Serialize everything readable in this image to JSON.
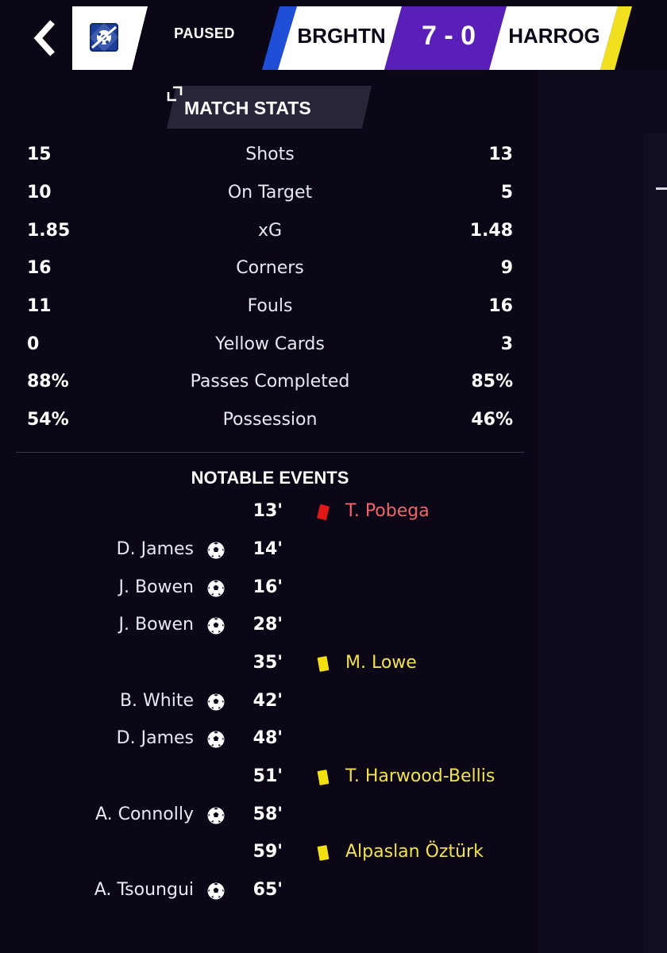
{
  "header": {
    "status": "PAUSED",
    "home_team": "BRGHTN",
    "away_team": "HARROG",
    "score": "7 - 0",
    "colors": {
      "home_stripe": "#1f4fd6",
      "score_bg": "#5a1fb8",
      "away_stripe": "#f0e020"
    }
  },
  "stats_tab": {
    "label": "MATCH STATS"
  },
  "stats": [
    {
      "label": "Shots",
      "home": "15",
      "away": "13"
    },
    {
      "label": "On Target",
      "home": "10",
      "away": "5"
    },
    {
      "label": "xG",
      "home": "1.85",
      "away": "1.48"
    },
    {
      "label": "Corners",
      "home": "16",
      "away": "9"
    },
    {
      "label": "Fouls",
      "home": "11",
      "away": "16"
    },
    {
      "label": "Yellow Cards",
      "home": "0",
      "away": "3"
    },
    {
      "label": "Passes Completed",
      "home": "88%",
      "away": "85%"
    },
    {
      "label": "Possession",
      "home": "54%",
      "away": "46%"
    }
  ],
  "events_title": "NOTABLE EVENTS",
  "events": [
    {
      "minute": "13'",
      "side": "away",
      "type": "red-card",
      "player": "T. Pobega"
    },
    {
      "minute": "14'",
      "side": "home",
      "type": "goal",
      "player": "D. James"
    },
    {
      "minute": "16'",
      "side": "home",
      "type": "goal",
      "player": "J. Bowen"
    },
    {
      "minute": "28'",
      "side": "home",
      "type": "goal",
      "player": "J. Bowen"
    },
    {
      "minute": "35'",
      "side": "away",
      "type": "yellow-card",
      "player": "M. Lowe"
    },
    {
      "minute": "42'",
      "side": "home",
      "type": "goal",
      "player": "B. White"
    },
    {
      "minute": "48'",
      "side": "home",
      "type": "goal",
      "player": "D. James"
    },
    {
      "minute": "51'",
      "side": "away",
      "type": "yellow-card",
      "player": "T. Harwood-Bellis"
    },
    {
      "minute": "58'",
      "side": "home",
      "type": "goal",
      "player": "A. Connolly"
    },
    {
      "minute": "59'",
      "side": "away",
      "type": "yellow-card",
      "player": "Alpaslan Öztürk"
    },
    {
      "minute": "65'",
      "side": "home",
      "type": "goal",
      "player": "A. Tsoungui"
    }
  ]
}
